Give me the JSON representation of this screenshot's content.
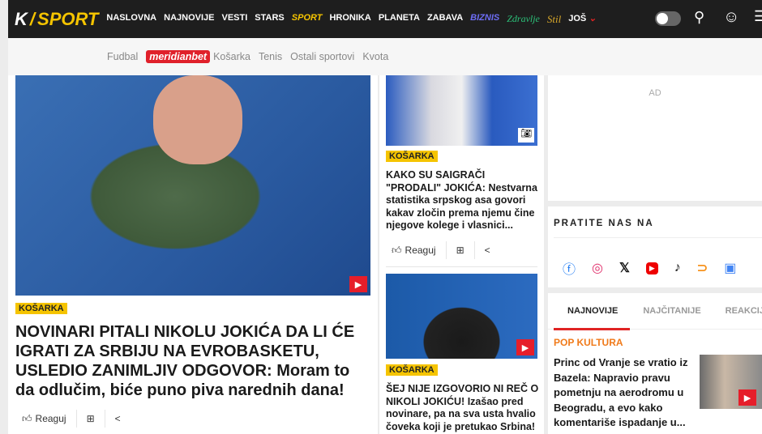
{
  "header": {
    "logo_k": "K",
    "logo_sport": "SPORT",
    "nav": [
      "NASLOVNA",
      "NAJNOVIJE",
      "VESTI",
      "STARS",
      "SPORT",
      "HRONIKA",
      "PLANETA",
      "ZABAVA",
      "BIZNIS",
      "Zdravlje",
      "Stil",
      "JOŠ"
    ],
    "active": "SPORT"
  },
  "subnav": {
    "items": [
      "Fudbal",
      "Košarka",
      "Tenis",
      "Ostali sportovi",
      "Kvota"
    ],
    "sponsor": "meridianbet"
  },
  "main_article": {
    "category": "KOŠARKA",
    "title": "NOVINARI PITALI NIKOLU JOKIĆA DA LI ĆE IGRATI ZA SRBIJU NA EVROBASKETU, USLEDIO ZANIMLJIV ODGOVOR: Moram to da odlučim, biće puno piva narednih dana!",
    "react": "Reaguj"
  },
  "articles": [
    {
      "category": "KOŠARKA",
      "title": "KAKO SU SAIGRAČI \"PRODALI\" JOKIĆA: Nestvarna statistika srpskog asa govori kakav zločin prema njemu čine njegove kolege i vlasnici...",
      "react": "Reaguj"
    },
    {
      "category": "KOŠARKA",
      "title": "ŠEJ NIJE IZGOVORIO NI REČ O NIKOLI JOKIĆU! Izašao pred novinare, pa na sva usta hvalio čoveka koji je pretukao Srbina!"
    }
  ],
  "sidebar": {
    "ad": "AD",
    "follow_title": "PRATITE NAS NA",
    "social": [
      "facebook",
      "instagram",
      "x",
      "youtube",
      "tiktok",
      "rss",
      "google-news"
    ],
    "tabs": [
      "NAJNOVIJE",
      "NAJČITANIJE",
      "REAKCIJE"
    ],
    "active_tab": "NAJNOVIJE",
    "news": {
      "category": "POP KULTURA",
      "title": "Princ od Vranje se vratio iz Bazela: Napravio pravu pometnju na aerodromu u Beogradu, a evo kako komentariše ispadanje u..."
    }
  },
  "colors": {
    "accent": "#f5c400",
    "red": "#e61e2a",
    "pop": "#f07a1a"
  }
}
